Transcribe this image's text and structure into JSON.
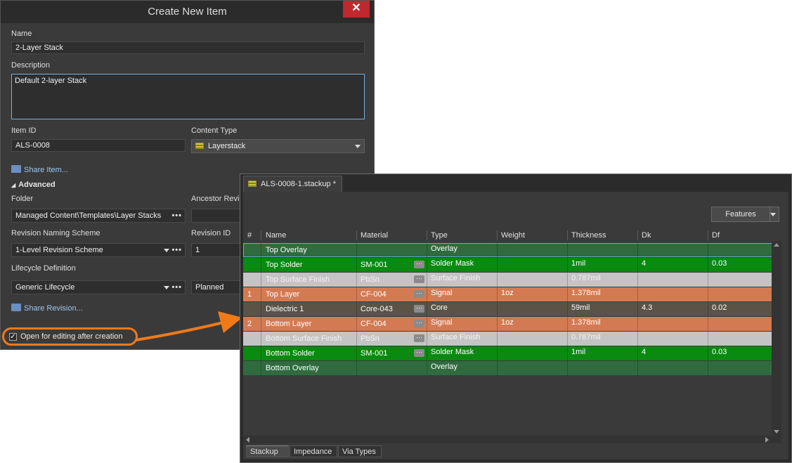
{
  "dialog": {
    "title": "Create New Item",
    "close_symbol": "✕",
    "name_label": "Name",
    "name_value": "2-Layer Stack",
    "description_label": "Description",
    "description_value": "Default 2-layer Stack",
    "item_id_label": "Item ID",
    "item_id_value": "ALS-0008",
    "content_type_label": "Content Type",
    "content_type_value": "Layerstack",
    "share_item_link": "Share Item...",
    "advanced_label": "Advanced",
    "advanced_arrow": "◢",
    "folder_label": "Folder",
    "folder_value": "Managed Content\\Templates\\Layer Stacks",
    "ancestor_label": "Ancestor Revi",
    "revision_scheme_label": "Revision Naming Scheme",
    "revision_scheme_value": "1-Level Revision Scheme",
    "revision_id_label": "Revision ID",
    "revision_id_value": "1",
    "lifecycle_label": "Lifecycle Definition",
    "lifecycle_value": "Generic Lifecycle",
    "lifecycle_state_value": "Planned",
    "share_revision_link": "Share Revision...",
    "open_for_editing_label": "Open for editing after creation",
    "open_for_editing_checked": "✓",
    "dots": "•••"
  },
  "stackup": {
    "tab_label": "ALS-0008-1.stackup *",
    "features_button": "Features",
    "columns": [
      "#",
      "Name",
      "Material",
      "Type",
      "Weight",
      "Thickness",
      "Dk",
      "Df"
    ],
    "material_button_symbol": "···",
    "rows": [
      {
        "num": "",
        "name": "Top Overlay",
        "material": "",
        "type": "Overlay",
        "weight": "",
        "thickness": "",
        "dk": "",
        "df": "",
        "color": "#2f6b3f",
        "text_color": "#ffffff",
        "has_mat_btn": false
      },
      {
        "num": "",
        "name": "Top Solder",
        "material": "SM-001",
        "type": "Solder Mask",
        "weight": "",
        "thickness": "1mil",
        "dk": "4",
        "df": "0.03",
        "color": "#0a8a10",
        "text_color": "#ffffff",
        "has_mat_btn": true
      },
      {
        "num": "",
        "name": "Top Surface Finish",
        "material": "PbSn",
        "type": "Surface Finish",
        "weight": "",
        "thickness": "0.787mil",
        "dk": "",
        "df": "",
        "color": "#c4c4c4",
        "text_color": "#f4f4f4",
        "has_mat_btn": true
      },
      {
        "num": "1",
        "name": "Top Layer",
        "material": "CF-004",
        "type": "Signal",
        "weight": "1oz",
        "thickness": "1.378mil",
        "dk": "",
        "df": "",
        "color": "#d47a52",
        "text_color": "#ffffff",
        "has_mat_btn": true
      },
      {
        "num": "",
        "name": "Dielectric 1",
        "material": "Core-043",
        "type": "Core",
        "weight": "",
        "thickness": "59mil",
        "dk": "4.3",
        "df": "0.02",
        "color": "#5a5346",
        "text_color": "#ffffff",
        "has_mat_btn": true
      },
      {
        "num": "2",
        "name": "Bottom Layer",
        "material": "CF-004",
        "type": "Signal",
        "weight": "1oz",
        "thickness": "1.378mil",
        "dk": "",
        "df": "",
        "color": "#d47a52",
        "text_color": "#ffffff",
        "has_mat_btn": true
      },
      {
        "num": "",
        "name": "Bottom Surface Finish",
        "material": "PbSn",
        "type": "Surface Finish",
        "weight": "",
        "thickness": "0.787mil",
        "dk": "",
        "df": "",
        "color": "#c4c4c4",
        "text_color": "#f4f4f4",
        "has_mat_btn": true
      },
      {
        "num": "",
        "name": "Bottom Solder",
        "material": "SM-001",
        "type": "Solder Mask",
        "weight": "",
        "thickness": "1mil",
        "dk": "4",
        "df": "0.03",
        "color": "#0a8a10",
        "text_color": "#ffffff",
        "has_mat_btn": true
      },
      {
        "num": "",
        "name": "Bottom Overlay",
        "material": "",
        "type": "Overlay",
        "weight": "",
        "thickness": "",
        "dk": "",
        "df": "",
        "color": "#2f6b3f",
        "text_color": "#ffffff",
        "has_mat_btn": false
      }
    ],
    "bottom_tabs": [
      "Stackup",
      "Impedance",
      "Via Types"
    ]
  },
  "colors": {
    "accent_orange": "#f07a1a",
    "close_red": "#c0282d",
    "link_blue": "#9ec7f0"
  }
}
